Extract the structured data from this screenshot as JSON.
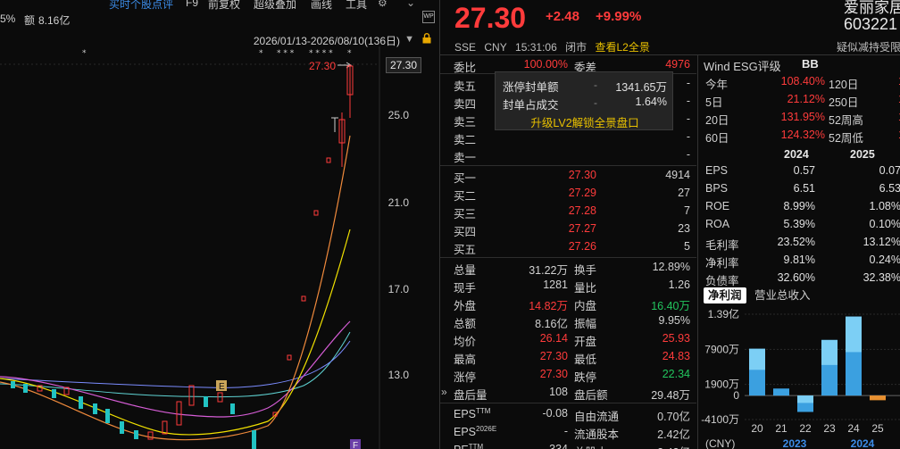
{
  "toolbar": {
    "items": [
      "买时个股点评",
      "F9",
      "前复权",
      "超级叠加",
      "画线",
      "工具"
    ]
  },
  "stats_line": {
    "pct": "5%",
    "amount_label": "额",
    "amount": "8.16亿"
  },
  "range": {
    "label": "2026/01/13-2026/08/10(136日)"
  },
  "axis": {
    "labels": [
      "25.0",
      "21.0",
      "17.0",
      "13.0"
    ],
    "current_price_tag": "27.30",
    "high_annotation": "27.30",
    "markers": [
      "E",
      "F"
    ]
  },
  "quote": {
    "price": "27.30",
    "change": "+2.48",
    "change_pct": "+9.99%",
    "name": "爱丽家居",
    "code": "603221",
    "exchange": "SSE",
    "currency": "CNY",
    "time": "15:31:06",
    "status": "闭市",
    "l2_link": "查看L2全景",
    "risk_note": "疑似减持受限"
  },
  "book": {
    "ratio_label": "委比",
    "ratio_value": "100.00%",
    "diff_label": "委差",
    "diff_value": "4976",
    "asks": [
      {
        "label": "卖五",
        "price": "",
        "vol": "-"
      },
      {
        "label": "卖四",
        "price": "",
        "vol": "-"
      },
      {
        "label": "卖三",
        "price": "",
        "vol": "-"
      },
      {
        "label": "卖二",
        "price": "-",
        "vol": "-"
      },
      {
        "label": "卖一",
        "price": "-",
        "vol": "-"
      }
    ],
    "bids": [
      {
        "label": "买一",
        "price": "27.30",
        "vol": "4914"
      },
      {
        "label": "买二",
        "price": "27.29",
        "vol": "27"
      },
      {
        "label": "买三",
        "price": "27.28",
        "vol": "7"
      },
      {
        "label": "买四",
        "price": "27.27",
        "vol": "23"
      },
      {
        "label": "买五",
        "price": "27.26",
        "vol": "5"
      }
    ]
  },
  "popup": {
    "rows": [
      {
        "label": "涨停封单额",
        "value": "1341.65万"
      },
      {
        "label": "封单占成交",
        "value": "1.64%"
      }
    ],
    "upgrade_link": "升级LV2解锁全景盘口"
  },
  "stats": [
    {
      "l1": "总量",
      "v1": "31.22万",
      "l2": "换手",
      "v2": "12.89%",
      "v1c": "#d0d0d0",
      "v2c": "#d0d0d0"
    },
    {
      "l1": "现手",
      "v1": "1281",
      "l2": "量比",
      "v2": "1.26",
      "v1c": "#d0d0d0",
      "v2c": "#d0d0d0"
    },
    {
      "l1": "外盘",
      "v1": "14.82万",
      "l2": "内盘",
      "v2": "16.40万",
      "v1c": "#ff3b3b",
      "v2c": "#22c55e"
    },
    {
      "l1": "总额",
      "v1": "8.16亿",
      "l2": "振幅",
      "v2": "9.95%",
      "v1c": "#d0d0d0",
      "v2c": "#d0d0d0"
    },
    {
      "l1": "均价",
      "v1": "26.14",
      "l2": "开盘",
      "v2": "25.93",
      "v1c": "#ff3b3b",
      "v2c": "#ff3b3b"
    },
    {
      "l1": "最高",
      "v1": "27.30",
      "l2": "最低",
      "v2": "24.83",
      "v1c": "#ff3b3b",
      "v2c": "#ff3b3b"
    },
    {
      "l1": "涨停",
      "v1": "27.30",
      "l2": "跌停",
      "v2": "22.34",
      "v1c": "#ff3b3b",
      "v2c": "#22c55e"
    },
    {
      "l1": "盘后量",
      "v1": "108",
      "l2": "盘后额",
      "v2": "29.48万",
      "v1c": "#d0d0d0",
      "v2c": "#d0d0d0"
    },
    {
      "l1": "EPS TTM",
      "v1": "-0.08",
      "l2": "自由流通",
      "v2": "0.70亿",
      "v1c": "#d0d0d0",
      "v2c": "#d0d0d0"
    },
    {
      "l1": "EPS 2026E",
      "v1": "-",
      "l2": "流通股本",
      "v2": "2.42亿",
      "v1c": "#d0d0d0",
      "v2c": "#d0d0d0"
    },
    {
      "l1": "PE TTM",
      "v1": "-334",
      "l2": "总股本",
      "v2": "2.42亿",
      "v1c": "#d0d0d0",
      "v2c": "#d0d0d0"
    }
  ],
  "esg": {
    "title": "Wind ESG评级",
    "grade": "BB"
  },
  "performance": [
    {
      "l1": "今年",
      "v1": "108.40%",
      "l2": "120日"
    },
    {
      "l1": "5日",
      "v1": "21.12%",
      "l2": "250日"
    },
    {
      "l1": "20日",
      "v1": "131.95%",
      "l2": "52周高"
    },
    {
      "l1": "60日",
      "v1": "124.32%",
      "l2": "52周低"
    }
  ],
  "financials": {
    "years": [
      "2024",
      "2025"
    ],
    "rows": [
      {
        "label": "EPS",
        "y1": "0.57",
        "y2": "0.07"
      },
      {
        "label": "BPS",
        "y1": "6.51",
        "y2": "6.53"
      },
      {
        "label": "ROE",
        "y1": "8.99%",
        "y2": "1.08%"
      },
      {
        "label": "ROA",
        "y1": "5.39%",
        "y2": "0.10%"
      },
      {
        "label": "毛利率",
        "y1": "23.52%",
        "y2": "13.12%"
      },
      {
        "label": "净利率",
        "y1": "9.81%",
        "y2": "0.24%"
      },
      {
        "label": "负债率",
        "y1": "32.60%",
        "y2": "32.38%"
      }
    ]
  },
  "tabs": [
    "净利润",
    "营业总收入"
  ],
  "chart_data": {
    "type": "bar",
    "title": "",
    "y_ticks": [
      "1.39亿",
      "7900万",
      "1900万",
      "0",
      "-4100万"
    ],
    "ylim": [
      -4100,
      13900
    ],
    "x_labels": [
      "20",
      "21",
      "22",
      "23",
      "24",
      "25"
    ],
    "year_labels": [
      "2023",
      "2024"
    ],
    "unit": "(CNY)",
    "series": [
      {
        "values": [
          8000,
          1200,
          -2800,
          9500,
          13500,
          -800
        ]
      }
    ]
  },
  "colors": {
    "up": "#ff3b3b",
    "down": "#22c55e",
    "accent": "#e8c000",
    "link": "#3c8ce7"
  }
}
